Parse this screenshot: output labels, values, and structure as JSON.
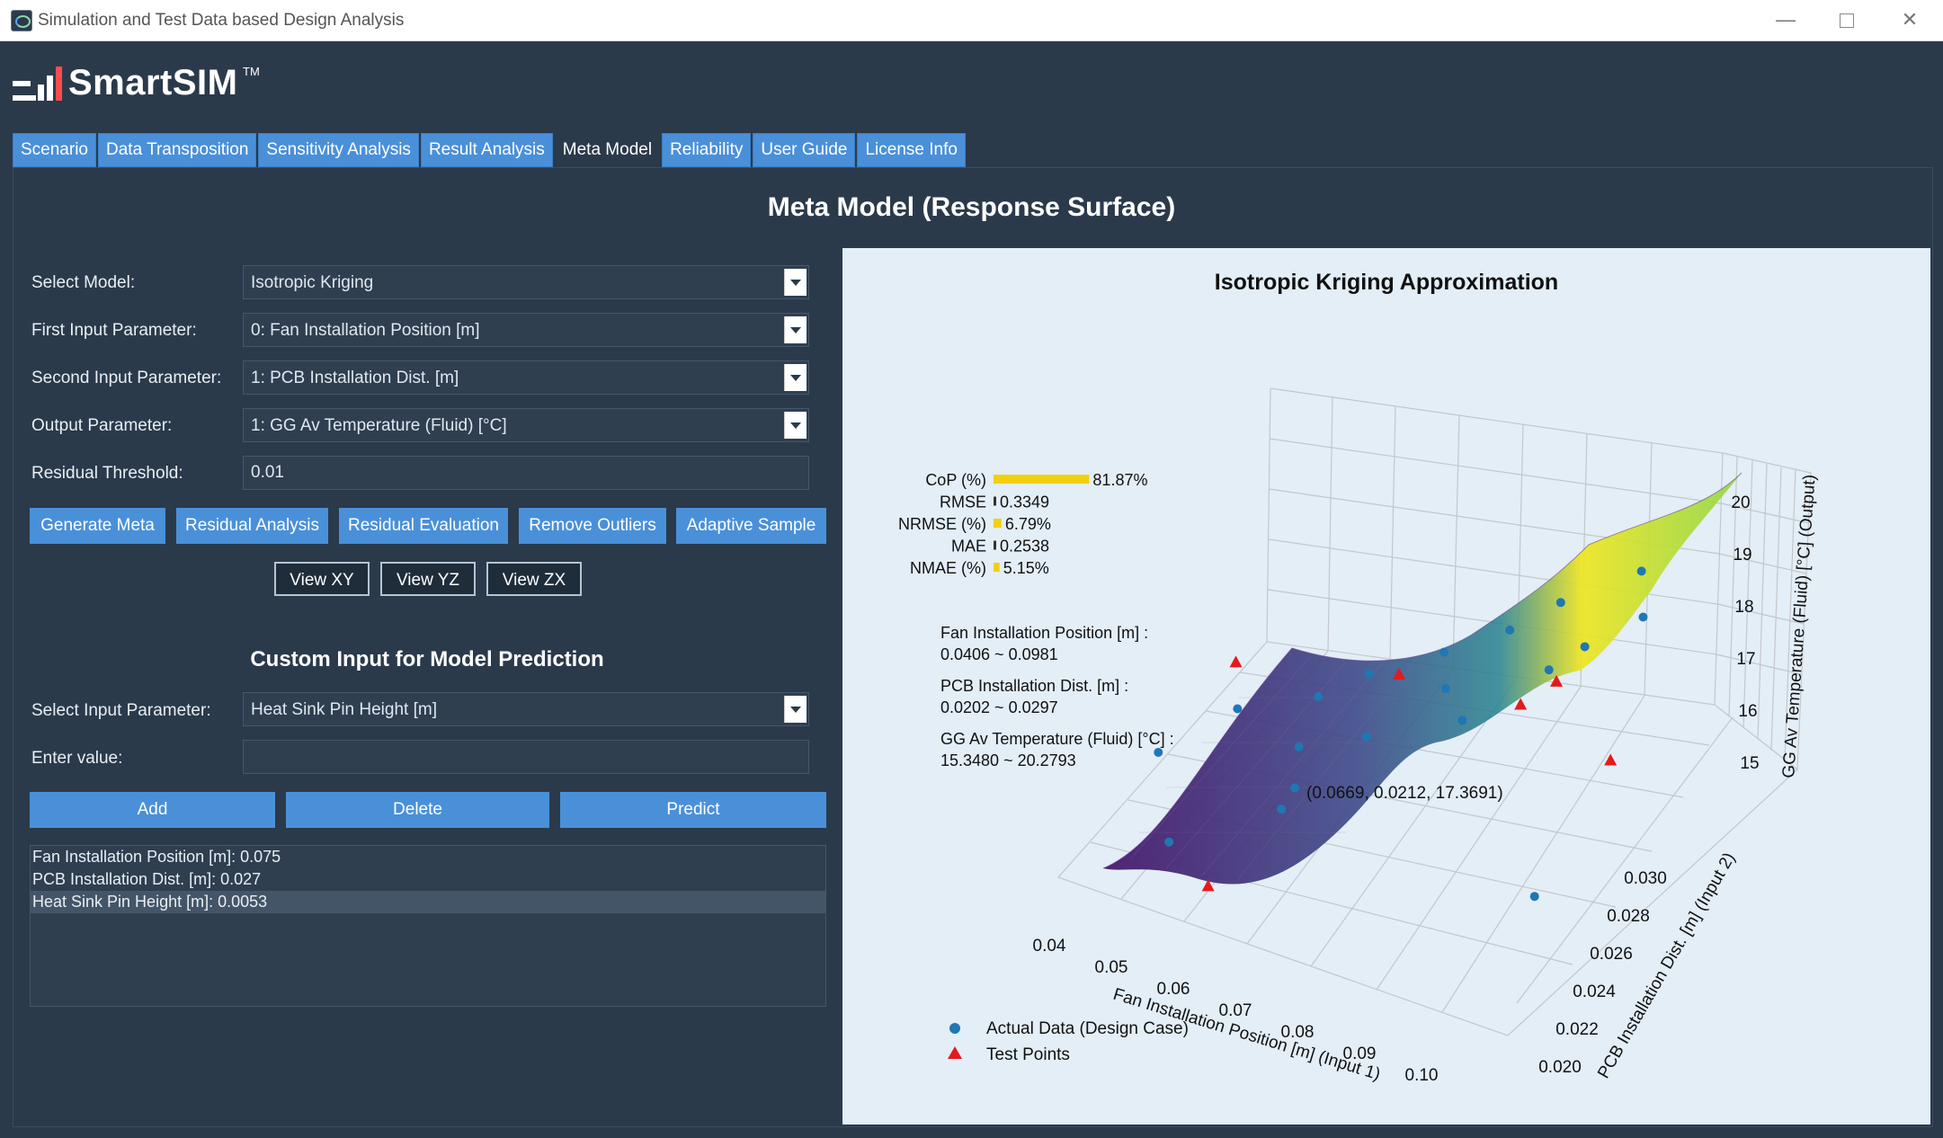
{
  "window": {
    "title": "Simulation and Test Data based Design Analysis",
    "minimize_glyph": "—",
    "close_glyph": "✕"
  },
  "logo": {
    "text": "SmartSIM",
    "tm": "TM"
  },
  "tabs": [
    {
      "label": "Scenario"
    },
    {
      "label": "Data Transposition"
    },
    {
      "label": "Sensitivity Analysis"
    },
    {
      "label": "Result Analysis"
    },
    {
      "label": "Meta Model",
      "active": true
    },
    {
      "label": "Reliability"
    },
    {
      "label": "User Guide"
    },
    {
      "label": "License Info"
    }
  ],
  "page_title": "Meta Model (Response Surface)",
  "form": {
    "select_model_label": "Select Model:",
    "select_model_value": "Isotropic Kriging",
    "first_input_label": "First Input Parameter:",
    "first_input_value": "0: Fan Installation Position [m]",
    "second_input_label": "Second Input Parameter:",
    "second_input_value": "1: PCB Installation Dist. [m]",
    "output_label": "Output Parameter:",
    "output_value": "1: GG Av Temperature (Fluid) [°C]",
    "residual_label": "Residual Threshold:",
    "residual_value": "0.01"
  },
  "actions": {
    "generate_meta": "Generate Meta",
    "residual_analysis": "Residual Analysis",
    "residual_evaluation": "Residual Evaluation",
    "remove_outliers": "Remove Outliers",
    "adaptive_sample": "Adaptive Sample"
  },
  "views": {
    "xy": "View XY",
    "yz": "View YZ",
    "zx": "View ZX"
  },
  "custom": {
    "title": "Custom Input for Model Prediction",
    "select_label": "Select Input Parameter:",
    "select_value": "Heat Sink Pin Height [m]",
    "enter_label": "Enter value:",
    "enter_value": "",
    "add": "Add",
    "delete": "Delete",
    "predict": "Predict",
    "list": [
      "Fan Installation Position [m]: 0.075",
      "PCB Installation Dist. [m]: 0.027",
      "Heat Sink Pin Height [m]: 0.0053"
    ],
    "selected_index": 2
  },
  "chart_data": {
    "type": "surface3d",
    "title": "Isotropic Kriging Approximation",
    "xlabel": "Fan Installation Position [m] (Input 1)",
    "ylabel": "PCB Installation Dist. [m] (Input 2)",
    "zlabel": "GG Av Temperature (Fluid) [°C] (Output)",
    "x_ticks": [
      "0.04",
      "0.05",
      "0.06",
      "0.07",
      "0.08",
      "0.09",
      "0.10"
    ],
    "y_ticks": [
      "0.020",
      "0.022",
      "0.024",
      "0.026",
      "0.028",
      "0.030"
    ],
    "z_ticks": [
      "15",
      "16",
      "17",
      "18",
      "19",
      "20"
    ],
    "metrics": [
      {
        "name": "CoP (%)",
        "value": 81.87,
        "label": "81.87%"
      },
      {
        "name": "RMSE",
        "value": 0.3349,
        "label": "0.3349"
      },
      {
        "name": "NRMSE (%)",
        "value": 6.79,
        "label": "6.79%"
      },
      {
        "name": "MAE",
        "value": 0.2538,
        "label": "0.2538"
      },
      {
        "name": "NMAE (%)",
        "value": 5.15,
        "label": "5.15%"
      }
    ],
    "ranges": [
      {
        "name": "Fan Installation Position [m] :",
        "range": "0.0406 ~ 0.0981"
      },
      {
        "name": "PCB Installation Dist. [m] :",
        "range": "0.0202 ~ 0.0297"
      },
      {
        "name": "GG Av Temperature (Fluid) [°C] :",
        "range": "15.3480 ~ 20.2793"
      }
    ],
    "annotation": "(0.0669, 0.0212, 17.3691)",
    "legend": [
      {
        "label": "Actual Data (Design Case)",
        "color": "#1f77b4",
        "marker": "circle"
      },
      {
        "label": "Test Points",
        "color": "#e41a1c",
        "marker": "triangle"
      }
    ],
    "colormap": "viridis"
  },
  "colors": {
    "accent": "#4a90d9",
    "background": "#2b3a4b",
    "chart_bg": "#e3eef7"
  }
}
